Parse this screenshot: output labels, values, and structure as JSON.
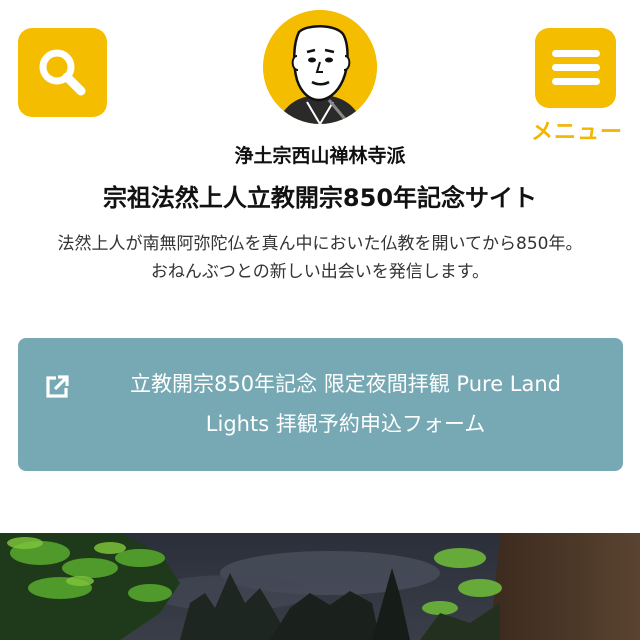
{
  "header": {
    "search_icon": "search-icon",
    "menu_icon": "hamburger-menu-icon",
    "menu_label": "メニュー",
    "logo": "priest-portrait-logo"
  },
  "sect_name": "浄土宗西山禅林寺派",
  "site_title": "宗祖法然上人立教開宗850年記念サイト",
  "description": {
    "line1": "法然上人が南無阿弥陀仏を真ん中においた仏教を開いてから850年。",
    "line2": "おねんぶつとの新しい出会いを発信します。"
  },
  "cta": {
    "icon": "external-link-icon",
    "line1": "立教開宗850年記念 限定夜間拝観 Pure Land",
    "line2": "Lights 拝観予約申込フォーム"
  },
  "colors": {
    "accent": "#f5bd00",
    "cta_bg": "#76a9b4"
  }
}
